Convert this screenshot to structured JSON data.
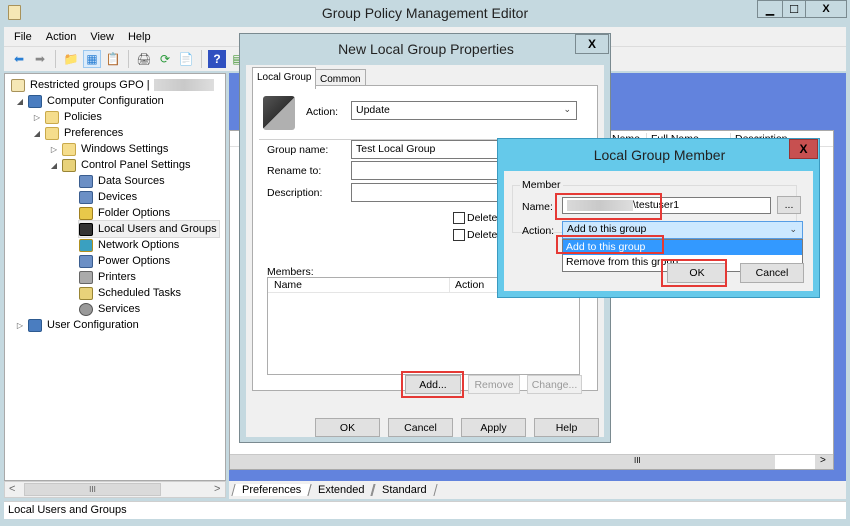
{
  "window": {
    "title": "Group Policy Management Editor",
    "controls": {
      "minimize": "▁",
      "maximize": "☐",
      "close": "X"
    }
  },
  "menu": [
    "File",
    "Action",
    "View",
    "Help"
  ],
  "toolbar": {
    "icons": [
      "back-icon",
      "forward-icon",
      "up-folder-icon",
      "show-hide-tree-icon",
      "clipboard-icon",
      "print-icon",
      "refresh-icon",
      "export-list-icon",
      "help-icon",
      "console-icon"
    ],
    "glyphs": [
      "⬅",
      "➡",
      "📁",
      "▦",
      "📋",
      "🖨",
      "⟳",
      "📄",
      "?",
      "▤"
    ]
  },
  "tree": {
    "root": "Restricted groups GPO |",
    "nodes": [
      {
        "label": "Computer Configuration",
        "expander": "◢",
        "icon": "computer"
      },
      {
        "label": "Policies",
        "expander": "▷",
        "icon": "folder"
      },
      {
        "label": "Preferences",
        "expander": "◢",
        "icon": "folder"
      },
      {
        "label": "Windows Settings",
        "expander": "▷",
        "icon": "folder"
      },
      {
        "label": "Control Panel Settings",
        "expander": "◢",
        "icon": "cp"
      },
      {
        "label": "Data Sources",
        "expander": "",
        "icon": "item"
      },
      {
        "label": "Devices",
        "expander": "",
        "icon": "item"
      },
      {
        "label": "Folder Options",
        "expander": "",
        "icon": "item"
      },
      {
        "label": "Local Users and Groups",
        "expander": "",
        "icon": "item",
        "selected": true
      },
      {
        "label": "Network Options",
        "expander": "",
        "icon": "item"
      },
      {
        "label": "Power Options",
        "expander": "",
        "icon": "item"
      },
      {
        "label": "Printers",
        "expander": "",
        "icon": "item"
      },
      {
        "label": "Scheduled Tasks",
        "expander": "",
        "icon": "item"
      },
      {
        "label": "Services",
        "expander": "",
        "icon": "item"
      },
      {
        "label": "User Configuration",
        "expander": "▷",
        "icon": "computer"
      }
    ],
    "scroll_left": "<",
    "scroll_right": ">",
    "scroll_grip": "III"
  },
  "right_pane": {
    "columns": [
      "Name",
      "Full Name",
      "Description"
    ],
    "bottom_tabs": [
      "Preferences",
      "Extended",
      "Standard"
    ],
    "scroll_right": ">",
    "scroll_grip": "III"
  },
  "status": "Local Users and Groups",
  "dialog1": {
    "title": "New Local Group Properties",
    "close": "X",
    "tabs": [
      "Local Group",
      "Common"
    ],
    "action_label": "Action:",
    "action_value": "Update",
    "group_name_label": "Group name:",
    "group_name_value": "Test Local Group",
    "rename_label": "Rename to:",
    "rename_value": "",
    "description_label": "Description:",
    "description_value": "",
    "checkbox1": "Delete",
    "checkbox2": "Delete",
    "members_label": "Members:",
    "members_columns": [
      "Name",
      "Action"
    ],
    "add_button": "Add...",
    "remove_button": "Remove",
    "change_button": "Change...",
    "ok": "OK",
    "cancel": "Cancel",
    "apply": "Apply",
    "help": "Help"
  },
  "dialog2": {
    "title": "Local Group Member",
    "close": "X",
    "group_label": "Member",
    "name_label": "Name:",
    "name_value": "\\testuser1",
    "browse": "...",
    "action_label": "Action:",
    "action_value": "Add to this group",
    "options": [
      "Add to this group",
      "Remove from this group"
    ],
    "ok": "OK",
    "cancel": "Cancel"
  }
}
